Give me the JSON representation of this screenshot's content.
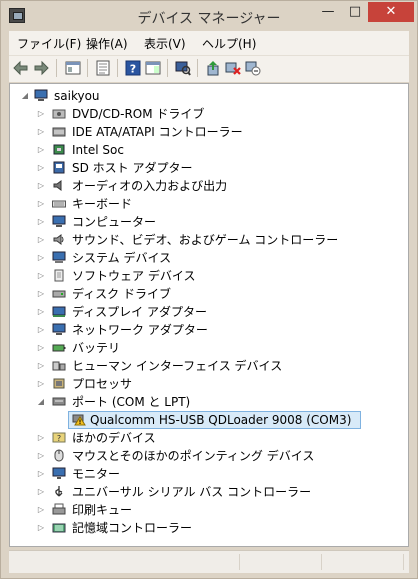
{
  "window": {
    "title": "デバイス マネージャー"
  },
  "title_buttons": {
    "minimize": "—",
    "maximize": "□",
    "close": "✕"
  },
  "menu": [
    "ファイル(F)",
    "操作(A)",
    "表示(V)",
    "ヘルプ(H)"
  ],
  "toolbar_icons": [
    "back-icon",
    "forward-icon",
    "properties-icon",
    "show-hidden-icon",
    "help-icon",
    "action-pane-icon",
    "scan-hardware-icon",
    "update-driver-icon",
    "uninstall-icon",
    "disable-icon"
  ],
  "tree": {
    "root": "saikyou",
    "categories": [
      {
        "label": "DVD/CD-ROM ドライブ",
        "icon": "dvd-drive-icon"
      },
      {
        "label": "IDE ATA/ATAPI コントローラー",
        "icon": "ide-controller-icon"
      },
      {
        "label": "Intel Soc",
        "icon": "chip-icon"
      },
      {
        "label": "SD ホスト アダプター",
        "icon": "sd-host-icon"
      },
      {
        "label": "オーディオの入力および出力",
        "icon": "speaker-icon"
      },
      {
        "label": "キーボード",
        "icon": "keyboard-icon"
      },
      {
        "label": "コンピューター",
        "icon": "computer-icon"
      },
      {
        "label": "サウンド、ビデオ、およびゲーム コントローラー",
        "icon": "sound-icon"
      },
      {
        "label": "システム デバイス",
        "icon": "system-device-icon"
      },
      {
        "label": "ソフトウェア デバイス",
        "icon": "software-device-icon"
      },
      {
        "label": "ディスク ドライブ",
        "icon": "disk-drive-icon"
      },
      {
        "label": "ディスプレイ アダプター",
        "icon": "display-adapter-icon"
      },
      {
        "label": "ネットワーク アダプター",
        "icon": "network-adapter-icon"
      },
      {
        "label": "バッテリ",
        "icon": "battery-icon"
      },
      {
        "label": "ヒューマン インターフェイス デバイス",
        "icon": "hid-icon"
      },
      {
        "label": "プロセッサ",
        "icon": "processor-icon"
      },
      {
        "label": "ポート (COM と LPT)",
        "icon": "port-icon",
        "expanded": true,
        "child": {
          "label": "Qualcomm HS-USB QDLoader 9008 (COM3)",
          "icon": "warning-port-icon"
        }
      },
      {
        "label": "ほかのデバイス",
        "icon": "unknown-device-icon"
      },
      {
        "label": "マウスとそのほかのポインティング デバイス",
        "icon": "mouse-icon"
      },
      {
        "label": "モニター",
        "icon": "monitor-icon"
      },
      {
        "label": "ユニバーサル シリアル バス コントローラー",
        "icon": "usb-icon"
      },
      {
        "label": "印刷キュー",
        "icon": "printer-icon"
      },
      {
        "label": "記憶域コントローラー",
        "icon": "storage-controller-icon"
      }
    ]
  }
}
